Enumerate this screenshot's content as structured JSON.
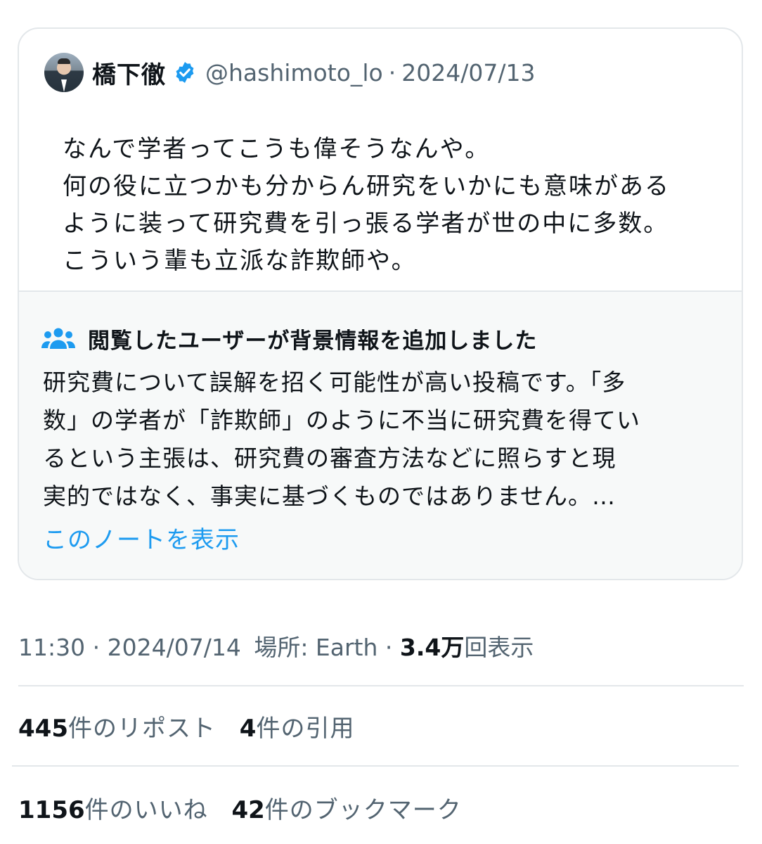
{
  "quoted_tweet": {
    "author_name": "橋下徹",
    "handle": "@hashimoto_lo",
    "separator": "·",
    "date": "2024/07/13",
    "text": "なんで学者ってこうも偉そうなんや。\n何の役に立つかも分からん研究をいかにも意味がある\nように装って研究費を引っ張る学者が世の中に多数。\nこういう輩も立派な詐欺師や。",
    "icons": {
      "avatar": "avatar",
      "verified": "verified-badge-icon"
    },
    "colors": {
      "verified": "#1d9bf0"
    }
  },
  "community_note": {
    "title": "閲覧したユーザーが背景情報を追加しました",
    "body": "研究費について誤解を招く可能性が高い投稿です。「多\n数」の学者が「詐欺師」のように不当に研究費を得てい\nるという主張は、研究費の審査方法などに照らすと現\n実的ではなく、事実に基づくものではありません。…",
    "link": "このノートを表示",
    "icon": "people-icon",
    "colors": {
      "link": "#1d9bf0",
      "background": "#f7f9f9"
    }
  },
  "meta": {
    "time": "11:30",
    "separator": "·",
    "date": "2024/07/14",
    "location": "場所: Earth",
    "views_number": "3.4万",
    "views_label": "回表示"
  },
  "stats": {
    "reposts": {
      "count": "445",
      "label": "件のリポスト"
    },
    "quotes": {
      "count": "4",
      "label": "件の引用"
    },
    "likes": {
      "count": "1156",
      "label": "件のいいね"
    },
    "bookmarks": {
      "count": "42",
      "label": "件のブックマーク"
    }
  }
}
